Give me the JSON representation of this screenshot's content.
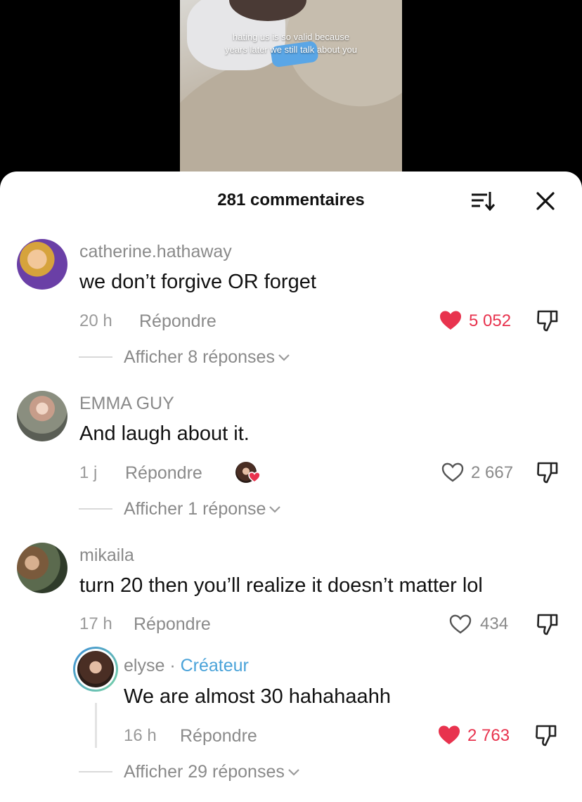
{
  "video": {
    "caption_line1": "hating us is so valid because",
    "caption_line2": "years later we still talk about you"
  },
  "header": {
    "title": "281 commentaires"
  },
  "comments": [
    {
      "username": "catherine.hathaway",
      "text": "we don’t forgive OR forget",
      "time": "20 h",
      "reply_label": "Répondre",
      "likes": "5 052",
      "liked": true,
      "view_replies": "Afficher 8 réponses"
    },
    {
      "username": "EMMA GUY",
      "text": "And laugh about it.",
      "time": "1 j",
      "reply_label": "Répondre",
      "likes": "2 667",
      "liked": false,
      "creator_liked": true,
      "view_replies": "Afficher 1 réponse"
    },
    {
      "username": "mikaila",
      "text": "turn 20 then you’ll realize it doesn’t matter lol",
      "time": "17 h",
      "reply_label": "Répondre",
      "likes": "434",
      "liked": false,
      "reply": {
        "username": "elyse",
        "separator": " · ",
        "creator_label": "Créateur",
        "text": "We are almost 30 hahahaahh",
        "time": "16 h",
        "reply_label": "Répondre",
        "likes": "2 763",
        "liked": true
      },
      "view_replies": "Afficher 29 réponses"
    }
  ],
  "colors": {
    "liked_red": "#e8334e",
    "creator_blue": "#4aa3d9",
    "muted_gray": "#8a8a8a"
  }
}
